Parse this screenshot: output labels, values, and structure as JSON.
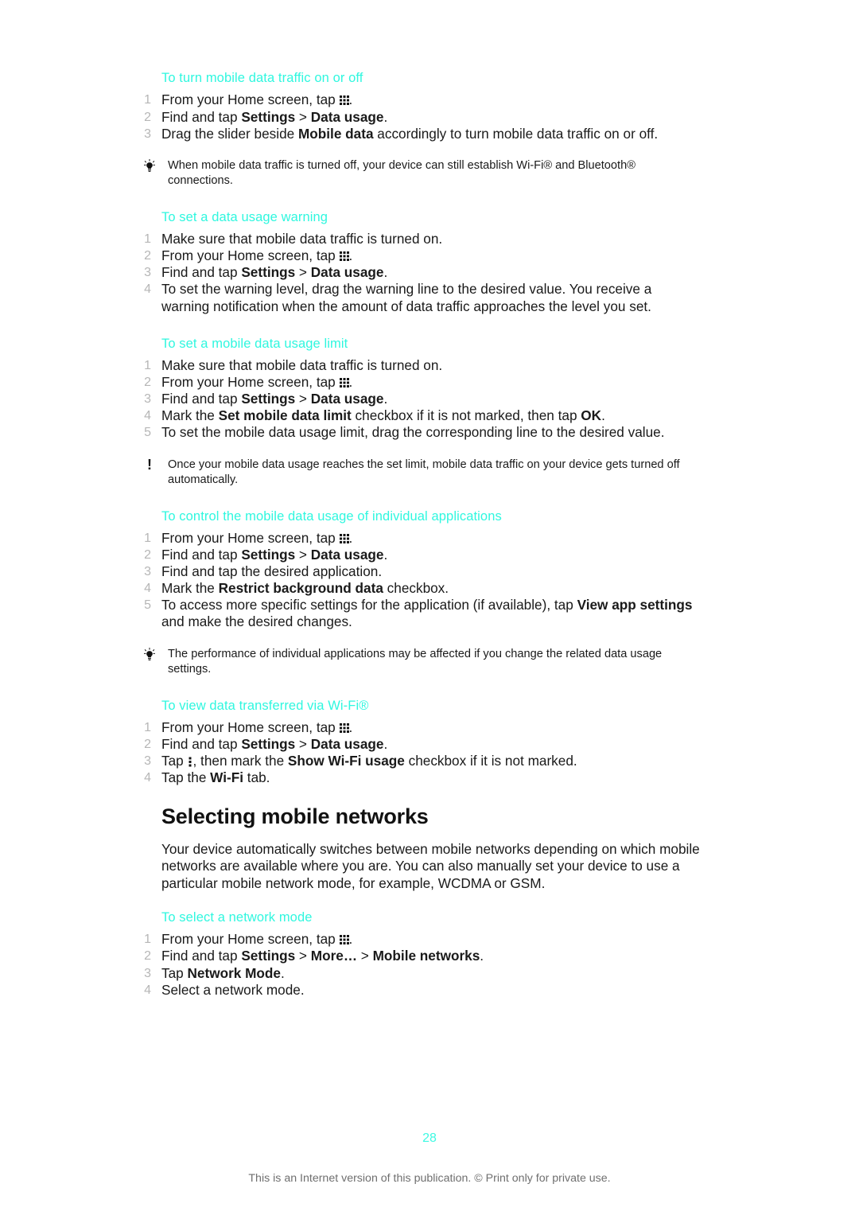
{
  "document": {
    "page_number": "28",
    "footer_note": "This is an Internet version of this publication. © Print only for private use.",
    "accent_color": "#2ff7df",
    "list_number_color": "#b6b6b6"
  },
  "icons": {
    "app_drawer": "app-drawer-grid-icon",
    "overflow": "overflow-menu-kebab-icon",
    "tip": "lightbulb-tip-icon",
    "note": "exclamation-note-icon"
  },
  "sections": [
    {
      "heading": "To turn mobile data traffic on or off",
      "steps": [
        {
          "num": "1",
          "parts": [
            {
              "t": "From your Home screen, tap "
            },
            {
              "icon": "app-drawer"
            },
            {
              "t": "."
            }
          ]
        },
        {
          "num": "2",
          "parts": [
            {
              "t": "Find and tap "
            },
            {
              "t": "Settings",
              "b": true
            },
            {
              "t": " > "
            },
            {
              "t": "Data usage",
              "b": true
            },
            {
              "t": "."
            }
          ]
        },
        {
          "num": "3",
          "parts": [
            {
              "t": "Drag the slider beside "
            },
            {
              "t": "Mobile data",
              "b": true
            },
            {
              "t": " accordingly to turn mobile data traffic on or off."
            }
          ]
        }
      ]
    },
    {
      "heading": "To set a data usage warning",
      "steps": [
        {
          "num": "1",
          "parts": [
            {
              "t": "Make sure that mobile data traffic is turned on."
            }
          ]
        },
        {
          "num": "2",
          "parts": [
            {
              "t": "From your Home screen, tap "
            },
            {
              "icon": "app-drawer"
            },
            {
              "t": "."
            }
          ]
        },
        {
          "num": "3",
          "parts": [
            {
              "t": "Find and tap "
            },
            {
              "t": "Settings",
              "b": true
            },
            {
              "t": " > "
            },
            {
              "t": "Data usage",
              "b": true
            },
            {
              "t": "."
            }
          ]
        },
        {
          "num": "4",
          "parts": [
            {
              "t": "To set the warning level, drag the warning line to the desired value. You receive a warning notification when the amount of data traffic approaches the level you set."
            }
          ]
        }
      ]
    },
    {
      "heading": "To set a mobile data usage limit",
      "steps": [
        {
          "num": "1",
          "parts": [
            {
              "t": "Make sure that mobile data traffic is turned on."
            }
          ]
        },
        {
          "num": "2",
          "parts": [
            {
              "t": "From your Home screen, tap "
            },
            {
              "icon": "app-drawer"
            },
            {
              "t": "."
            }
          ]
        },
        {
          "num": "3",
          "parts": [
            {
              "t": "Find and tap "
            },
            {
              "t": "Settings",
              "b": true
            },
            {
              "t": " > "
            },
            {
              "t": "Data usage",
              "b": true
            },
            {
              "t": "."
            }
          ]
        },
        {
          "num": "4",
          "parts": [
            {
              "t": "Mark the "
            },
            {
              "t": "Set mobile data limit",
              "b": true
            },
            {
              "t": " checkbox if it is not marked, then tap "
            },
            {
              "t": "OK",
              "b": true
            },
            {
              "t": "."
            }
          ]
        },
        {
          "num": "5",
          "parts": [
            {
              "t": "To set the mobile data usage limit, drag the corresponding line to the desired value."
            }
          ]
        }
      ]
    },
    {
      "heading": "To control the mobile data usage of individual applications",
      "steps": [
        {
          "num": "1",
          "parts": [
            {
              "t": "From your Home screen, tap "
            },
            {
              "icon": "app-drawer"
            },
            {
              "t": "."
            }
          ]
        },
        {
          "num": "2",
          "parts": [
            {
              "t": "Find and tap "
            },
            {
              "t": "Settings",
              "b": true
            },
            {
              "t": " > "
            },
            {
              "t": "Data usage",
              "b": true
            },
            {
              "t": "."
            }
          ]
        },
        {
          "num": "3",
          "parts": [
            {
              "t": "Find and tap the desired application."
            }
          ]
        },
        {
          "num": "4",
          "parts": [
            {
              "t": "Mark the "
            },
            {
              "t": "Restrict background data",
              "b": true
            },
            {
              "t": " checkbox."
            }
          ]
        },
        {
          "num": "5",
          "parts": [
            {
              "t": "To access more specific settings for the application (if available), tap "
            },
            {
              "t": "View app settings",
              "b": true
            },
            {
              "t": " and make the desired changes."
            }
          ]
        }
      ]
    },
    {
      "heading": "To view data transferred via Wi-Fi®",
      "steps": [
        {
          "num": "1",
          "parts": [
            {
              "t": "From your Home screen, tap "
            },
            {
              "icon": "app-drawer"
            },
            {
              "t": "."
            }
          ]
        },
        {
          "num": "2",
          "parts": [
            {
              "t": "Find and tap "
            },
            {
              "t": "Settings",
              "b": true
            },
            {
              "t": " > "
            },
            {
              "t": "Data usage",
              "b": true
            },
            {
              "t": "."
            }
          ]
        },
        {
          "num": "3",
          "parts": [
            {
              "t": "Tap "
            },
            {
              "icon": "overflow"
            },
            {
              "t": ", then mark the "
            },
            {
              "t": "Show Wi-Fi usage",
              "b": true
            },
            {
              "t": " checkbox if it is not marked."
            }
          ]
        },
        {
          "num": "4",
          "parts": [
            {
              "t": "Tap the "
            },
            {
              "t": "Wi-Fi",
              "b": true
            },
            {
              "t": " tab."
            }
          ]
        }
      ]
    },
    {
      "heading": "To select a network mode",
      "steps": [
        {
          "num": "1",
          "parts": [
            {
              "t": "From your Home screen, tap "
            },
            {
              "icon": "app-drawer"
            },
            {
              "t": "."
            }
          ]
        },
        {
          "num": "2",
          "parts": [
            {
              "t": "Find and tap "
            },
            {
              "t": "Settings",
              "b": true
            },
            {
              "t": " > "
            },
            {
              "t": "More…",
              "b": true
            },
            {
              "t": " > "
            },
            {
              "t": "Mobile networks",
              "b": true
            },
            {
              "t": "."
            }
          ]
        },
        {
          "num": "3",
          "parts": [
            {
              "t": "Tap "
            },
            {
              "t": "Network Mode",
              "b": true
            },
            {
              "t": "."
            }
          ]
        },
        {
          "num": "4",
          "parts": [
            {
              "t": "Select a network mode."
            }
          ]
        }
      ]
    }
  ],
  "callouts": {
    "tip_mobile_data_off": {
      "type": "tip",
      "text": "When mobile data traffic is turned off, your device can still establish Wi-Fi® and Bluetooth® connections."
    },
    "note_data_limit": {
      "type": "note",
      "text": "Once your mobile data usage reaches the set limit, mobile data traffic on your device gets turned off automatically."
    },
    "tip_app_performance": {
      "type": "tip",
      "text": "The performance of individual applications may be affected if you change the related data usage settings."
    }
  },
  "main_heading": {
    "title": "Selecting mobile networks",
    "paragraph": "Your device automatically switches between mobile networks depending on which mobile networks are available where you are. You can also manually set your device to use a particular mobile network mode, for example, WCDMA or GSM."
  }
}
